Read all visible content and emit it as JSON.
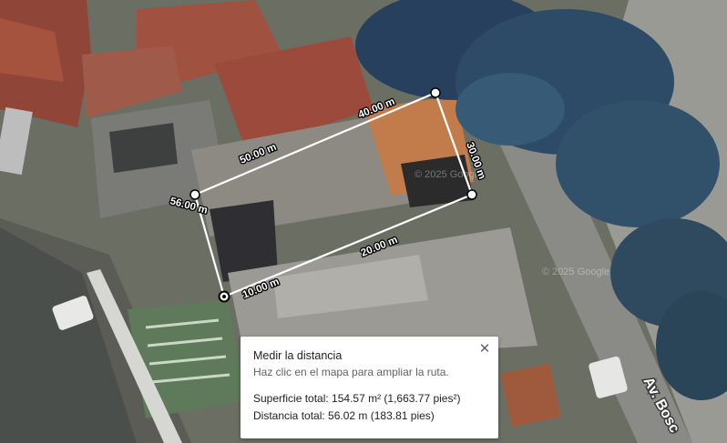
{
  "measure_panel": {
    "title": "Medir la distancia",
    "hint": "Haz clic en el mapa para ampliar la ruta.",
    "area_label": "Superficie total: 154.57 m² (1,663.77 pies²)",
    "distance_label": "Distancia total: 56.02 m (183.81 pies)",
    "close_icon": "close-icon"
  },
  "segment_labels": {
    "top_right": "40.00 m",
    "top_left": "50.00 m",
    "right": "30.00 m",
    "left": "56.00 m",
    "bottom_middle": "20.00 m",
    "bottom_left": "10.00 m"
  },
  "street_label": "Av. Bosc",
  "watermarks": [
    "© 2025 Google",
    "© 2025 Google"
  ],
  "colors": {
    "roof_red": "#9a4a3a",
    "tree_blue": "#2f4a6a",
    "measure_line": "#ffffff"
  }
}
